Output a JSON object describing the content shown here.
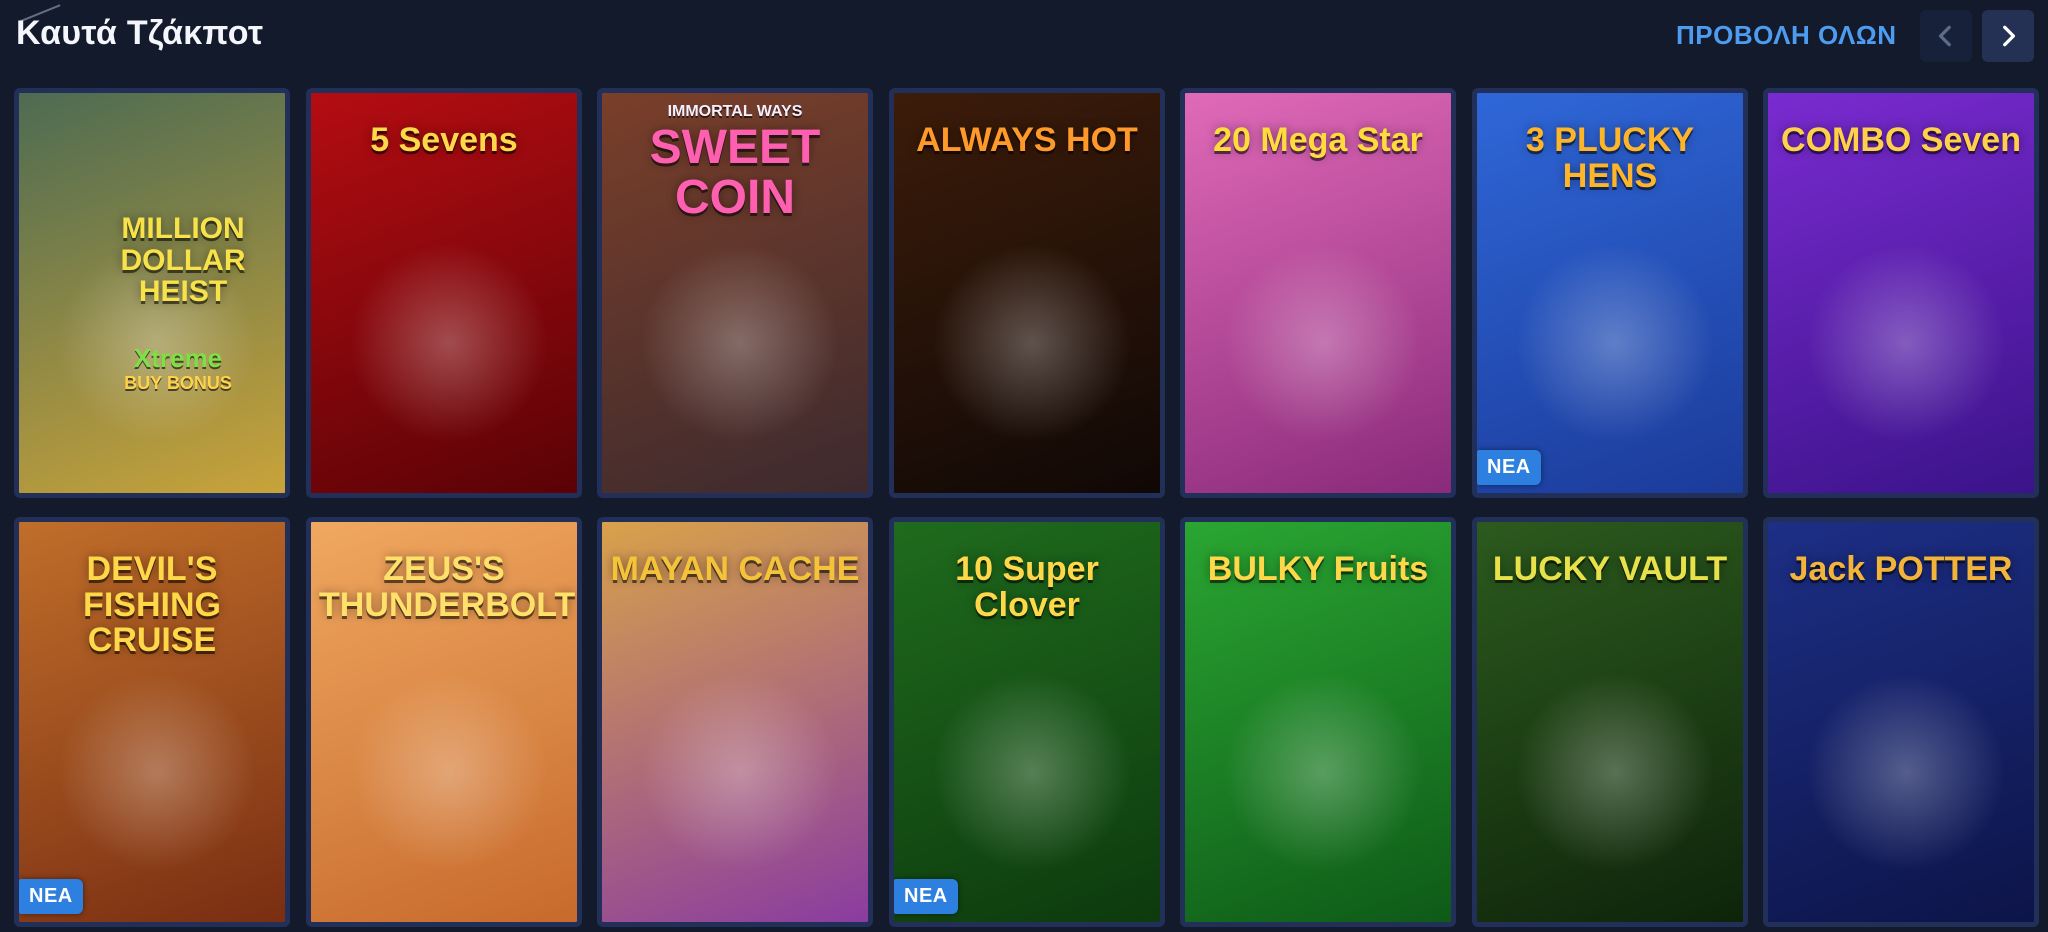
{
  "header": {
    "title": "Καυτά Τζάκποτ",
    "view_all_label": "ΠΡΟΒΟΛΗ ΟΛΩΝ"
  },
  "badge_new_label": "ΝΕΑ",
  "games": [
    {
      "title": "MILLION DOLLAR HEIST",
      "subtitle": "Xtreme",
      "extra": "BUY BONUS",
      "new": false,
      "colors": [
        "#4d6b52",
        "#c9a33a"
      ]
    },
    {
      "title": "5 Sevens",
      "subtitle": "",
      "extra": "",
      "new": false,
      "colors": [
        "#b40d12",
        "#5a0206"
      ]
    },
    {
      "title": "SWEET COIN",
      "subtitle": "IMMORTAL WAYS",
      "extra": "",
      "new": false,
      "colors": [
        "#7a3f2a",
        "#3d2a2e"
      ]
    },
    {
      "title": "ALWAYS HOT",
      "subtitle": "",
      "extra": "",
      "new": false,
      "colors": [
        "#3c1c0a",
        "#100806"
      ]
    },
    {
      "title": "20 Mega Star",
      "subtitle": "",
      "extra": "",
      "new": false,
      "colors": [
        "#e06ab8",
        "#8a2a7a"
      ]
    },
    {
      "title": "3 PLUCKY HENS",
      "subtitle": "",
      "extra": "",
      "new": true,
      "colors": [
        "#2f67d8",
        "#1b3b9a"
      ]
    },
    {
      "title": "COMBO Seven",
      "subtitle": "",
      "extra": "",
      "new": false,
      "colors": [
        "#7a2bd0",
        "#3b138a"
      ]
    },
    {
      "title": "DEVIL'S FISHING CRUISE",
      "subtitle": "",
      "extra": "",
      "new": true,
      "colors": [
        "#c06e2a",
        "#7a2e12"
      ]
    },
    {
      "title": "ZEUS'S THUNDERBOLT",
      "subtitle": "",
      "extra": "",
      "new": false,
      "colors": [
        "#f0a860",
        "#c76a2c"
      ]
    },
    {
      "title": "MAYAN CACHE",
      "subtitle": "",
      "extra": "",
      "new": false,
      "colors": [
        "#d8a24a",
        "#8a3ca0"
      ]
    },
    {
      "title": "10 Super Clover",
      "subtitle": "",
      "extra": "",
      "new": true,
      "colors": [
        "#1f6b1d",
        "#0d3a0e"
      ]
    },
    {
      "title": "BULKY Fruits",
      "subtitle": "",
      "extra": "",
      "new": false,
      "colors": [
        "#2aa632",
        "#0e5a18"
      ]
    },
    {
      "title": "LUCKY VAULT",
      "subtitle": "",
      "extra": "",
      "new": false,
      "colors": [
        "#2c5a1e",
        "#0e240a"
      ]
    },
    {
      "title": "Jack POTTER",
      "subtitle": "",
      "extra": "",
      "new": false,
      "colors": [
        "#1d2f86",
        "#0d1448"
      ]
    }
  ],
  "icons": {
    "prev": "chevron-left-icon",
    "next": "chevron-right-icon"
  }
}
